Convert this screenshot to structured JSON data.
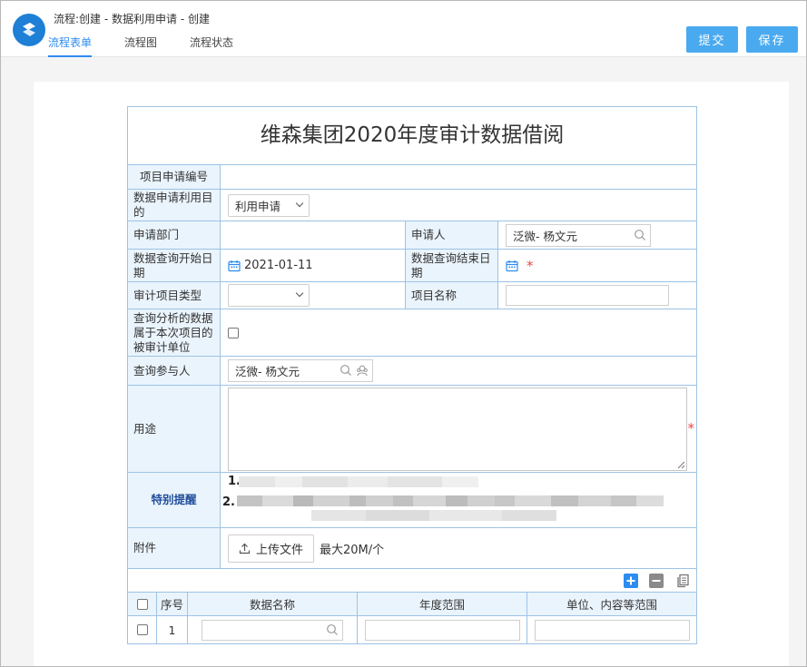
{
  "window": {
    "title": "流程:创建 - 数据利用申请 - 创建",
    "tabs": [
      {
        "label": "流程表单",
        "active": true
      },
      {
        "label": "流程图",
        "active": false
      },
      {
        "label": "流程状态",
        "active": false
      }
    ],
    "buttons": {
      "submit": "提交",
      "save": "保存"
    }
  },
  "colors": {
    "accent": "#2d8cf0",
    "button": "#4aaaf0",
    "label_bg": "#eaf4fd",
    "border": "#9cc3e6",
    "required": "#e94848"
  },
  "form": {
    "title": "维森集团2020年度审计数据借阅",
    "fields": {
      "project_no": {
        "label": "项目申请编号",
        "value": ""
      },
      "purpose_type": {
        "label": "数据申请利用目的",
        "value": "利用申请"
      },
      "department": {
        "label": "申请部门",
        "value": ""
      },
      "applicant": {
        "label": "申请人",
        "value": "泛微- 杨文元"
      },
      "start_date": {
        "label": "数据查询开始日期",
        "value": "2021-01-11"
      },
      "end_date": {
        "label": "数据查询结束日期",
        "value": ""
      },
      "audit_type": {
        "label": "审计项目类型",
        "value": ""
      },
      "project_name": {
        "label": "项目名称",
        "value": ""
      },
      "belongs_unit": {
        "label": "查询分析的数据属于本次项目的被审计单位",
        "checked": false
      },
      "participants": {
        "label": "查询参与人",
        "value": "泛微- 杨文元"
      },
      "usage": {
        "label": "用途",
        "value": ""
      }
    },
    "notice": {
      "label": "特别提醒",
      "items": [
        "1.",
        "2."
      ]
    },
    "attachment": {
      "label": "附件",
      "button": "上传文件",
      "note": "最大20M/个"
    },
    "detail_table": {
      "columns": [
        "序号",
        "数据名称",
        "年度范围",
        "单位、内容等范围"
      ],
      "rows": [
        {
          "index": "1",
          "data_name": "",
          "year_range": "",
          "scope": ""
        }
      ]
    }
  },
  "icons": [
    "app-logo-icon",
    "search-icon",
    "calendar-icon",
    "chevron-down-icon",
    "org-picker-icon",
    "upload-icon",
    "add-row-icon",
    "delete-row-icon",
    "copy-row-icon"
  ]
}
